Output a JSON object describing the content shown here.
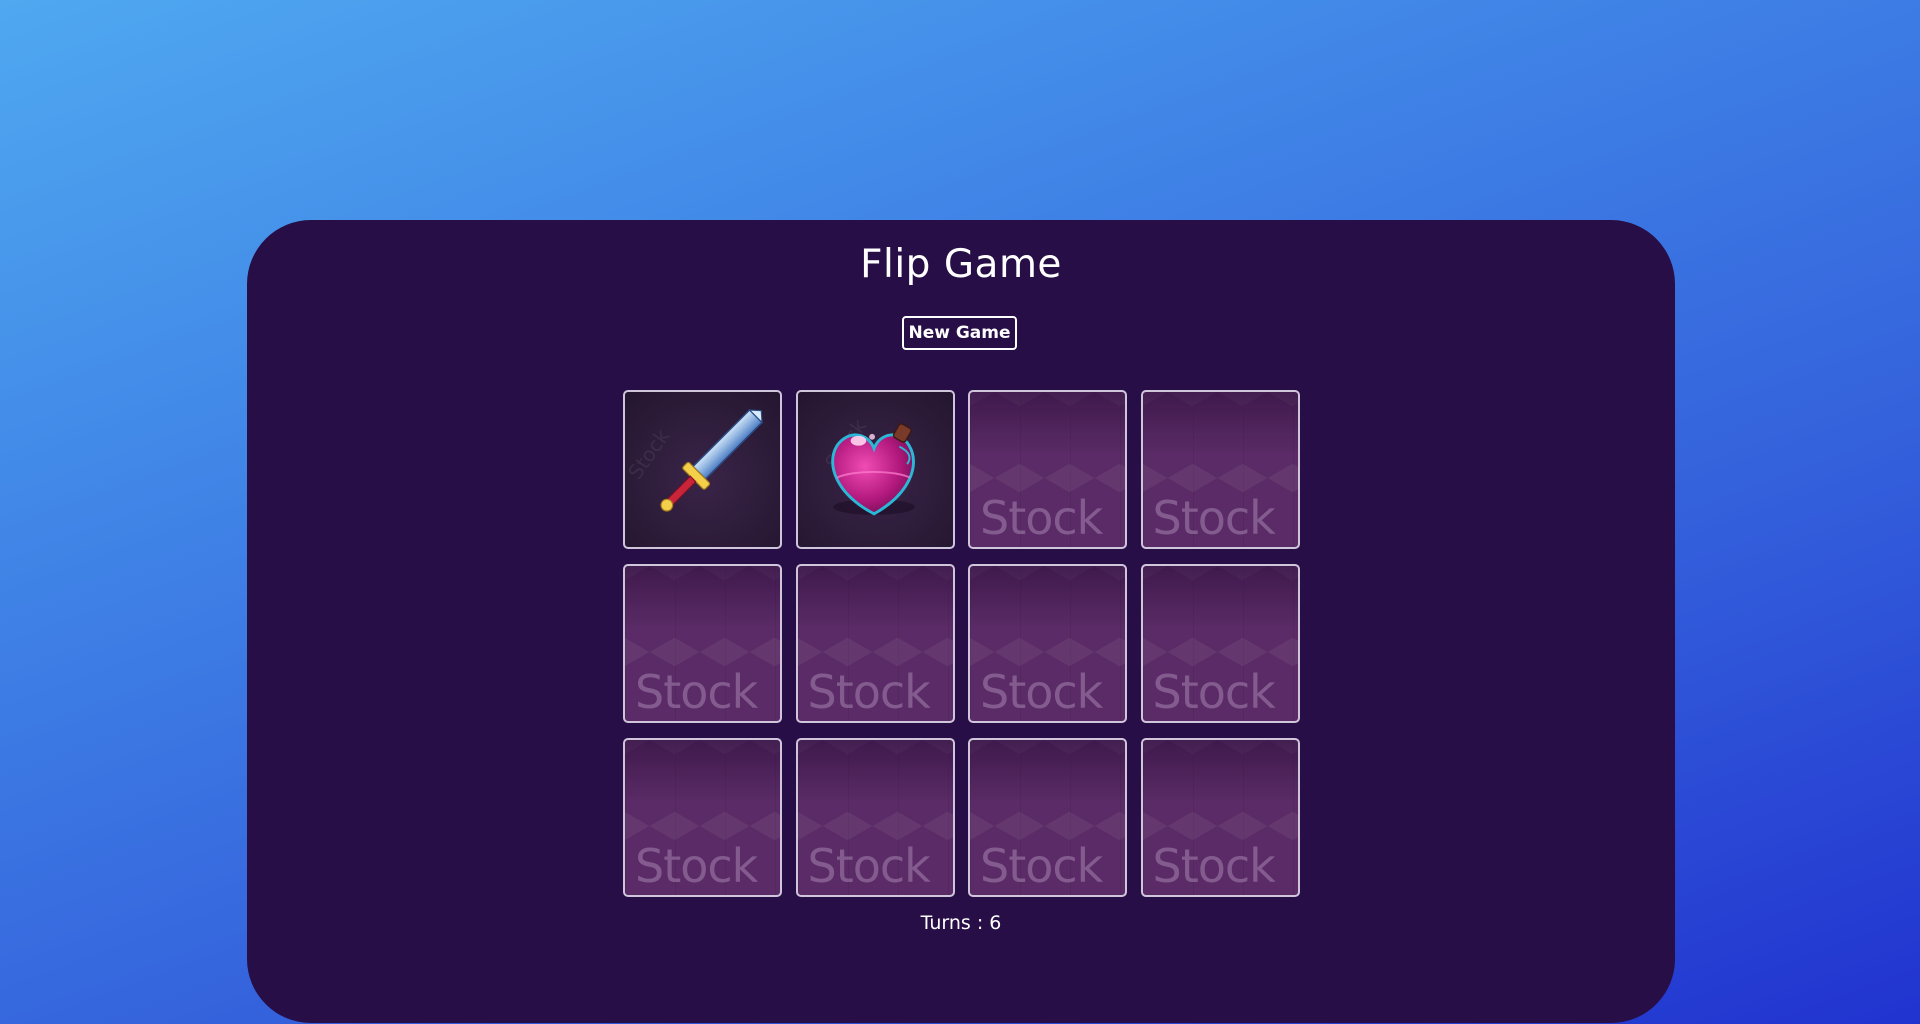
{
  "game": {
    "title": "Flip Game",
    "new_game_label": "New Game",
    "turns_label": "Turns : 6",
    "card_back_watermark": "Stock",
    "cards": [
      {
        "state": "face-up",
        "icon": "sword-icon"
      },
      {
        "state": "face-up",
        "icon": "potion-icon"
      },
      {
        "state": "face-down"
      },
      {
        "state": "face-down"
      },
      {
        "state": "face-down"
      },
      {
        "state": "face-down"
      },
      {
        "state": "face-down"
      },
      {
        "state": "face-down"
      },
      {
        "state": "face-down"
      },
      {
        "state": "face-down"
      },
      {
        "state": "face-down"
      },
      {
        "state": "face-down"
      }
    ]
  },
  "colors": {
    "background_top": "#4fa8f0",
    "background_bottom": "#2133cf",
    "panel": "#270e46",
    "card_border": "#cfc6dc",
    "card_back": "#5a2b66"
  }
}
